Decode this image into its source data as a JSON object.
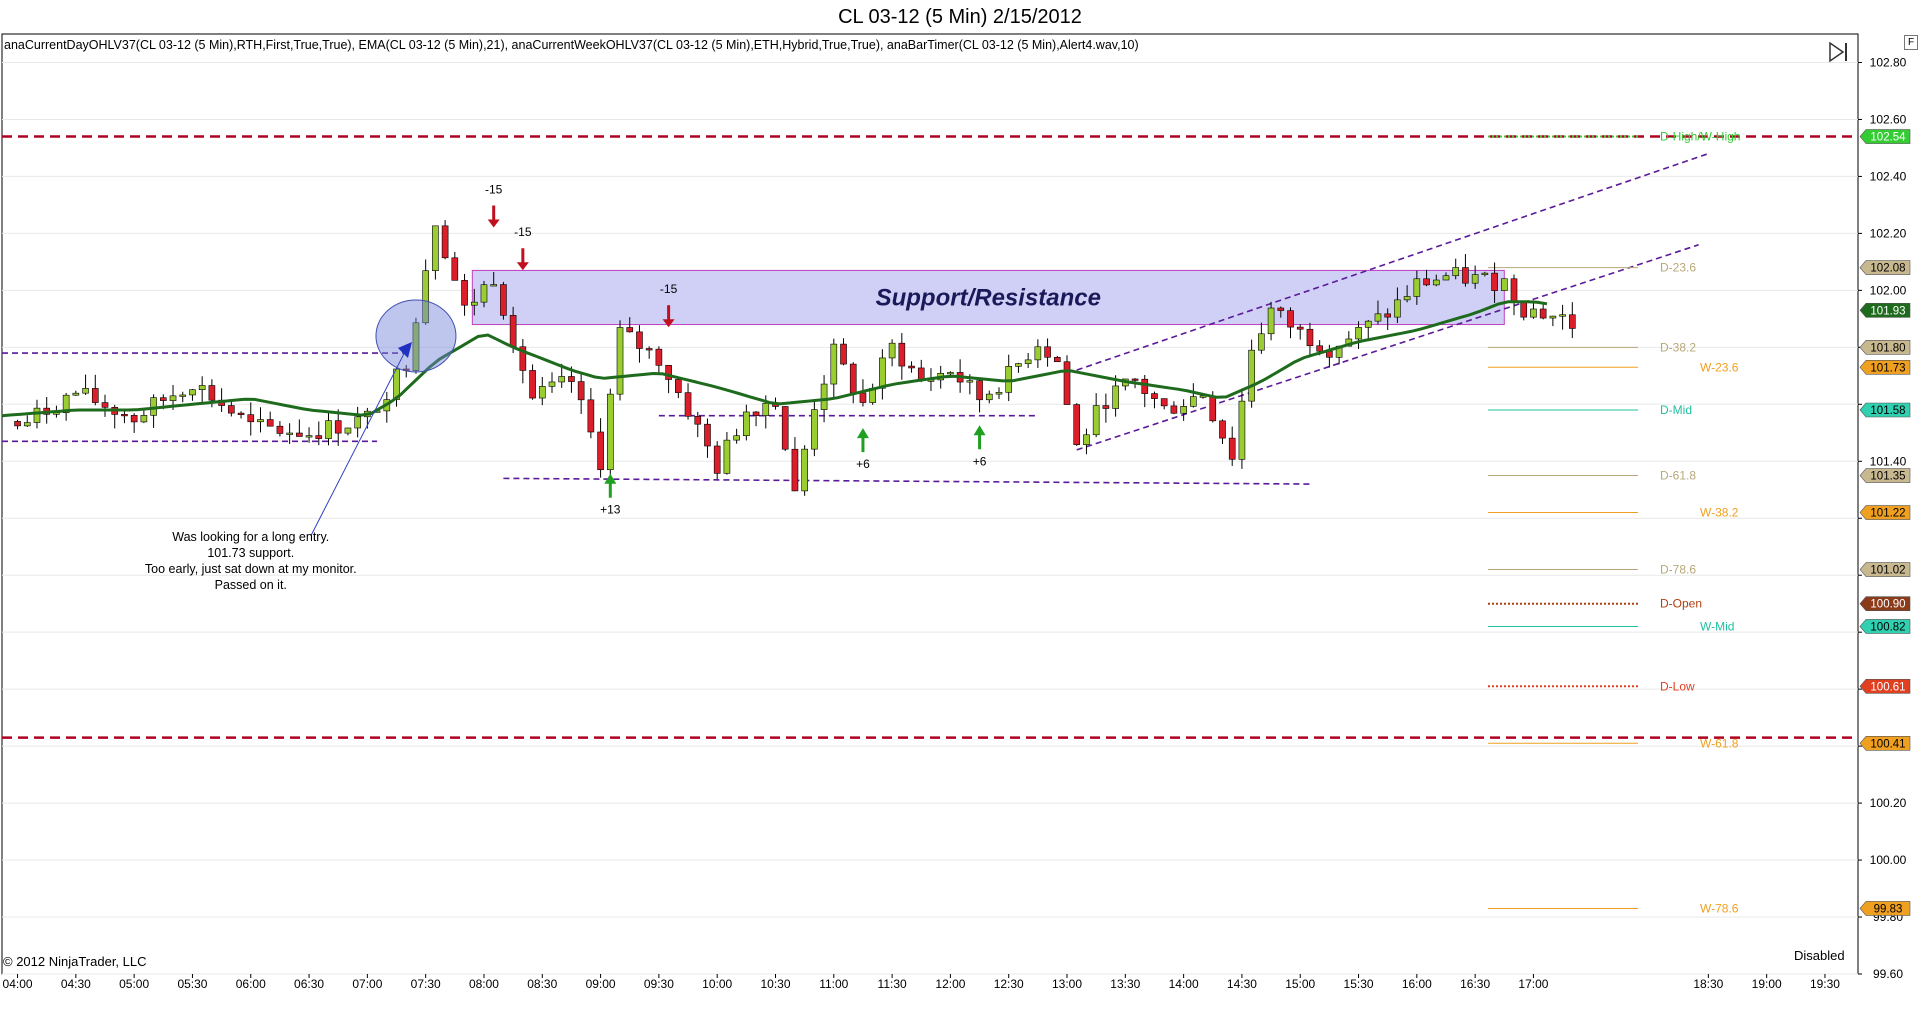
{
  "title": "CL 03-12 (5 Min)  2/15/2012",
  "indicators": "anaCurrentDayOHLV37(CL 03-12 (5 Min),RTH,First,True,True),  EMA(CL 03-12 (5 Min),21),  anaCurrentWeekOHLV37(CL 03-12 (5 Min),ETH,Hybrid,True,True),  anaBarTimer(CL 03-12 (5 Min),Alert4.wav,10)",
  "copyright": "© 2012 NinjaTrader, LLC",
  "status": "Disabled",
  "f_label": "F",
  "icons": {
    "play": "play-pause-icon"
  },
  "colors": {
    "up": "#9ACD32",
    "down": "#DC1E2A",
    "ema": "#1E6B1E",
    "pivot": "#B00020",
    "zone": "#C8C8F5",
    "channel": "#5A1A9A"
  },
  "chart_data": {
    "type": "candlestick",
    "ylim": [
      99.6,
      102.9
    ],
    "xlim": [
      "03:52",
      "19:47"
    ],
    "x_ticks": [
      "04:00",
      "04:30",
      "05:00",
      "05:30",
      "06:00",
      "06:30",
      "07:00",
      "07:30",
      "08:00",
      "08:30",
      "09:00",
      "09:30",
      "10:00",
      "10:30",
      "11:00",
      "11:30",
      "12:00",
      "12:30",
      "13:00",
      "13:30",
      "14:00",
      "14:30",
      "15:00",
      "15:30",
      "16:00",
      "16:30",
      "17:00",
      "18:30",
      "19:00",
      "19:30"
    ],
    "y_ticks": [
      99.6,
      99.8,
      100.0,
      100.2,
      100.4,
      100.6,
      100.8,
      101.0,
      101.2,
      101.4,
      101.6,
      101.8,
      102.0,
      102.2,
      102.4,
      102.6,
      102.8
    ],
    "y_tick_labels": [
      "99.60",
      "99.80",
      "100.00",
      "100.20",
      "",
      "",
      "",
      "",
      "",
      "101.40",
      "",
      "",
      "102.00",
      "102.20",
      "102.40",
      "102.60",
      "102.80"
    ],
    "close_anchors": [
      [
        "04:00",
        101.52
      ],
      [
        "04:30",
        101.64
      ],
      [
        "05:00",
        101.55
      ],
      [
        "05:30",
        101.68
      ],
      [
        "06:00",
        101.52
      ],
      [
        "06:30",
        101.5
      ],
      [
        "07:00",
        101.55
      ],
      [
        "07:20",
        101.75
      ],
      [
        "07:35",
        102.25
      ],
      [
        "07:50",
        101.93
      ],
      [
        "08:05",
        102.05
      ],
      [
        "08:25",
        101.62
      ],
      [
        "08:45",
        101.68
      ],
      [
        "09:00",
        101.4
      ],
      [
        "09:10",
        101.85
      ],
      [
        "09:30",
        101.76
      ],
      [
        "09:45",
        101.58
      ],
      [
        "10:00",
        101.38
      ],
      [
        "10:15",
        101.58
      ],
      [
        "10:30",
        101.62
      ],
      [
        "10:40",
        101.28
      ],
      [
        "10:50",
        101.6
      ],
      [
        "11:00",
        101.78
      ],
      [
        "11:15",
        101.6
      ],
      [
        "11:30",
        101.8
      ],
      [
        "11:45",
        101.68
      ],
      [
        "12:00",
        101.72
      ],
      [
        "12:15",
        101.62
      ],
      [
        "12:30",
        101.7
      ],
      [
        "12:45",
        101.82
      ],
      [
        "12:55",
        101.75
      ],
      [
        "13:05",
        101.45
      ],
      [
        "13:20",
        101.62
      ],
      [
        "13:35",
        101.68
      ],
      [
        "13:50",
        101.58
      ],
      [
        "14:10",
        101.64
      ],
      [
        "14:25",
        101.42
      ],
      [
        "14:35",
        101.8
      ],
      [
        "14:45",
        101.93
      ],
      [
        "15:00",
        101.85
      ],
      [
        "15:15",
        101.8
      ],
      [
        "15:30",
        101.85
      ],
      [
        "15:45",
        101.92
      ],
      [
        "16:00",
        102.02
      ],
      [
        "16:15",
        102.05
      ],
      [
        "16:30",
        102.04
      ],
      [
        "16:45",
        102.03
      ],
      [
        "16:55",
        101.94
      ],
      [
        "17:05",
        101.92
      ],
      [
        "17:15",
        101.9
      ],
      [
        "17:20",
        101.88
      ]
    ],
    "ema_anchors": [
      [
        "03:52",
        101.56
      ],
      [
        "04:30",
        101.58
      ],
      [
        "05:00",
        101.58
      ],
      [
        "05:30",
        101.6
      ],
      [
        "06:00",
        101.62
      ],
      [
        "06:30",
        101.58
      ],
      [
        "07:00",
        101.56
      ],
      [
        "07:15",
        101.62
      ],
      [
        "07:35",
        101.75
      ],
      [
        "08:00",
        101.85
      ],
      [
        "08:15",
        101.8
      ],
      [
        "08:30",
        101.76
      ],
      [
        "08:45",
        101.72
      ],
      [
        "09:00",
        101.69
      ],
      [
        "09:15",
        101.7
      ],
      [
        "09:30",
        101.71
      ],
      [
        "10:00",
        101.66
      ],
      [
        "10:30",
        101.6
      ],
      [
        "11:00",
        101.62
      ],
      [
        "11:30",
        101.67
      ],
      [
        "12:00",
        101.7
      ],
      [
        "12:30",
        101.68
      ],
      [
        "13:00",
        101.72
      ],
      [
        "13:30",
        101.68
      ],
      [
        "14:00",
        101.65
      ],
      [
        "14:20",
        101.62
      ],
      [
        "14:40",
        101.68
      ],
      [
        "15:00",
        101.76
      ],
      [
        "15:30",
        101.82
      ],
      [
        "16:00",
        101.86
      ],
      [
        "16:30",
        101.92
      ],
      [
        "16:45",
        101.96
      ],
      [
        "17:00",
        101.96
      ],
      [
        "17:10",
        101.95
      ]
    ],
    "levels": [
      {
        "label": "D-High/W-High",
        "price": 102.54,
        "tag": "102.54",
        "color": "#33CC33",
        "tag_bg": "#33CC33",
        "tag_fg": "#ffffff",
        "style": "dotted"
      },
      {
        "label": "D-23.6",
        "price": 102.08,
        "tag": "102.08",
        "color": "#B8A878",
        "tag_bg": "#C8B890",
        "tag_fg": "#000000",
        "style": "solid"
      },
      {
        "label": "",
        "price": 101.93,
        "tag": "101.93",
        "color": "#1E6B1E",
        "tag_bg": "#1E6B1E",
        "tag_fg": "#ffffff",
        "style": "none"
      },
      {
        "label": "D-38.2",
        "price": 101.8,
        "tag": "101.80",
        "color": "#B8A878",
        "tag_bg": "#C8B890",
        "tag_fg": "#000000",
        "style": "solid"
      },
      {
        "label": "W-23.6",
        "price": 101.73,
        "tag": "101.73",
        "color": "#F0A020",
        "tag_bg": "#F0A020",
        "tag_fg": "#000000",
        "style": "solid"
      },
      {
        "label": "D-Mid",
        "price": 101.58,
        "tag": "101.58",
        "color": "#20C0A0",
        "tag_bg": "#30D0B0",
        "tag_fg": "#000000",
        "style": "solid"
      },
      {
        "label": "D-61.8",
        "price": 101.35,
        "tag": "101.35",
        "color": "#B8A878",
        "tag_bg": "#C8B890",
        "tag_fg": "#000000",
        "style": "solid"
      },
      {
        "label": "W-38.2",
        "price": 101.22,
        "tag": "101.22",
        "color": "#F0A020",
        "tag_bg": "#F0A020",
        "tag_fg": "#000000",
        "style": "solid"
      },
      {
        "label": "D-78.6",
        "price": 101.02,
        "tag": "101.02",
        "color": "#B8A878",
        "tag_bg": "#C8B890",
        "tag_fg": "#000000",
        "style": "solid"
      },
      {
        "label": "D-Open",
        "price": 100.9,
        "tag": "100.90",
        "color": "#B04010",
        "tag_bg": "#8B3A1A",
        "tag_fg": "#ffffff",
        "style": "dotted"
      },
      {
        "label": "W-Mid",
        "price": 100.82,
        "tag": "100.82",
        "color": "#20C0A0",
        "tag_bg": "#30D0B0",
        "tag_fg": "#000000",
        "style": "solid"
      },
      {
        "label": "D-Low",
        "price": 100.61,
        "tag": "100.61",
        "color": "#E04020",
        "tag_bg": "#E04020",
        "tag_fg": "#ffffff",
        "style": "dotted"
      },
      {
        "label": "W-61.8",
        "price": 100.41,
        "tag": "100.41",
        "color": "#F0A020",
        "tag_bg": "#F0A020",
        "tag_fg": "#000000",
        "style": "solid"
      },
      {
        "label": "W-78.6",
        "price": 99.83,
        "tag": "99.83",
        "color": "#F0A020",
        "tag_bg": "#F0A020",
        "tag_fg": "#000000",
        "style": "solid"
      }
    ],
    "pivot_lines": [
      102.54,
      100.43
    ],
    "zone": {
      "label": "Support/Resistance",
      "x1": "07:54",
      "x2": "16:45",
      "y_top": 102.07,
      "y_bottom": 101.88
    },
    "dashed_lines": [
      {
        "x1": "03:52",
        "y1": 101.78,
        "x2": "07:20",
        "y2": 101.78
      },
      {
        "x1": "03:52",
        "y1": 101.47,
        "x2": "07:05",
        "y2": 101.47
      },
      {
        "x1": "08:10",
        "y1": 101.34,
        "x2": "15:05",
        "y2": 101.32
      },
      {
        "x1": "09:30",
        "y1": 101.56,
        "x2": "12:45",
        "y2": 101.56
      },
      {
        "x1": "13:05",
        "y1": 101.72,
        "x2": "18:30",
        "y2": 102.48
      },
      {
        "x1": "13:05",
        "y1": 101.44,
        "x2": "18:25",
        "y2": 102.16
      }
    ],
    "annotations": [
      {
        "text": "-15",
        "x": "08:05",
        "y": 102.34,
        "arrow": "down"
      },
      {
        "text": "-15",
        "x": "08:20",
        "y": 102.19,
        "arrow": "down"
      },
      {
        "text": "-15",
        "x": "09:35",
        "y": 101.99,
        "arrow": "down"
      },
      {
        "text": "+13",
        "x": "09:05",
        "y": 101.23,
        "arrow": "up"
      },
      {
        "text": "+6",
        "x": "11:15",
        "y": 101.39,
        "arrow": "up"
      },
      {
        "text": "+6",
        "x": "12:15",
        "y": 101.4,
        "arrow": "up"
      }
    ],
    "note": {
      "lines": [
        "Was looking for a long entry.",
        "101.73 support.",
        "Too early, just sat down at my monitor.",
        "Passed on it."
      ],
      "x": "06:00",
      "y": 101.12
    },
    "circle": {
      "x": "07:25",
      "y": 101.84
    }
  }
}
